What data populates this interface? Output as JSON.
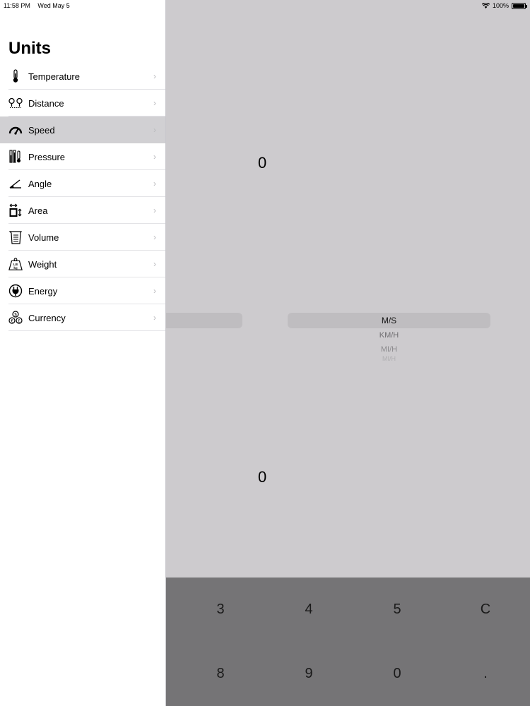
{
  "status": {
    "time": "11:58 PM",
    "date": "Wed May 5",
    "battery": "100%"
  },
  "sidebar": {
    "title": "Units",
    "items": [
      {
        "label": "Temperature",
        "icon": "thermometer-icon"
      },
      {
        "label": "Distance",
        "icon": "distance-pins-icon"
      },
      {
        "label": "Speed",
        "icon": "speedometer-icon",
        "selected": true
      },
      {
        "label": "Pressure",
        "icon": "pressure-gauge-icon"
      },
      {
        "label": "Angle",
        "icon": "angle-icon"
      },
      {
        "label": "Area",
        "icon": "area-icon"
      },
      {
        "label": "Volume",
        "icon": "volume-icon"
      },
      {
        "label": "Weight",
        "icon": "weight-icon"
      },
      {
        "label": "Energy",
        "icon": "energy-plug-icon"
      },
      {
        "label": "Currency",
        "icon": "currency-coins-icon"
      }
    ]
  },
  "main": {
    "top_value": "0",
    "bottom_value": "0",
    "picker_units": [
      "M/S",
      "KM/H",
      "MI/H",
      "MI/H"
    ],
    "keypad": [
      "3",
      "4",
      "5",
      "C",
      "8",
      "9",
      "0",
      "."
    ]
  }
}
